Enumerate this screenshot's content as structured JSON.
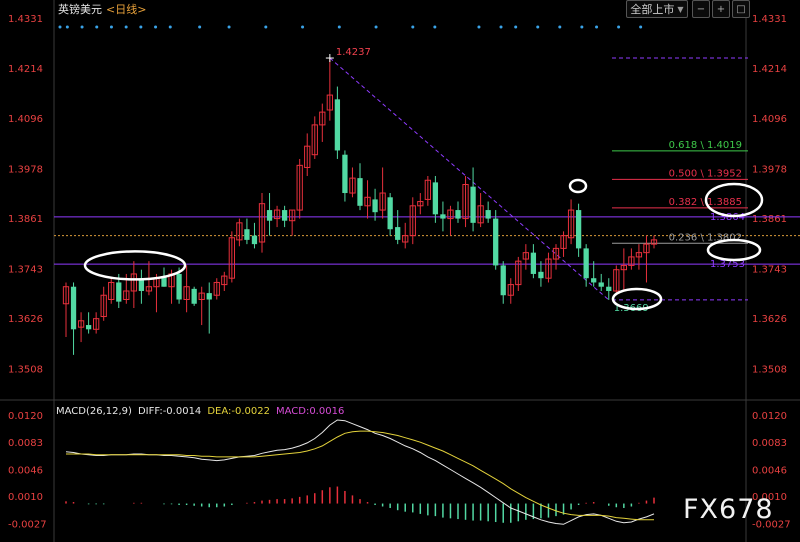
{
  "header": {
    "title": "英镑美元",
    "subtitle": "<日线>",
    "dropdown_label": "全部上市",
    "dropdown_arrow": "▼"
  },
  "macd_header": {
    "label": "MACD(26,12,9)",
    "diff": "DIFF:-0.0014",
    "dea": "DEA:-0.0022",
    "macd": "MACD:0.0016"
  },
  "watermark": "FX678",
  "colors": {
    "background": "#000000",
    "up": "#e8303c",
    "down": "#52d9a3",
    "fib_618": "#3ec94a",
    "fib_500": "#e8304c",
    "fib_382": "#e8304c",
    "fib_236": "#9c9c9c",
    "resistance_line": "#8f3bff",
    "diff_line": "#e6e6e6",
    "dea_line": "#e3d23b",
    "label_price": "#f1414e",
    "label_green": "#52d9a3",
    "axis_text": "#e84141"
  },
  "chart_data": [
    {
      "type": "candlestick",
      "y_ticks": [
        "1.4331",
        "1.4214",
        "1.4096",
        "1.3978",
        "1.3861",
        "1.3743",
        "1.3626",
        "1.3508"
      ],
      "ylim": [
        1.3434,
        1.4331
      ],
      "candles": [
        {
          "o": 1.366,
          "h": 1.371,
          "l": 1.3582,
          "c": 1.37
        },
        {
          "o": 1.37,
          "h": 1.371,
          "l": 1.354,
          "c": 1.36
        },
        {
          "o": 1.3605,
          "h": 1.364,
          "l": 1.357,
          "c": 1.362
        },
        {
          "o": 1.361,
          "h": 1.364,
          "l": 1.359,
          "c": 1.36
        },
        {
          "o": 1.36,
          "h": 1.364,
          "l": 1.359,
          "c": 1.3625
        },
        {
          "o": 1.363,
          "h": 1.37,
          "l": 1.362,
          "c": 1.368
        },
        {
          "o": 1.367,
          "h": 1.372,
          "l": 1.366,
          "c": 1.371
        },
        {
          "o": 1.371,
          "h": 1.373,
          "l": 1.365,
          "c": 1.3665
        },
        {
          "o": 1.367,
          "h": 1.373,
          "l": 1.366,
          "c": 1.369
        },
        {
          "o": 1.369,
          "h": 1.376,
          "l": 1.365,
          "c": 1.373
        },
        {
          "o": 1.372,
          "h": 1.374,
          "l": 1.366,
          "c": 1.369
        },
        {
          "o": 1.369,
          "h": 1.376,
          "l": 1.368,
          "c": 1.37
        },
        {
          "o": 1.37,
          "h": 1.373,
          "l": 1.364,
          "c": 1.372
        },
        {
          "o": 1.3725,
          "h": 1.3745,
          "l": 1.37,
          "c": 1.37
        },
        {
          "o": 1.37,
          "h": 1.374,
          "l": 1.366,
          "c": 1.373
        },
        {
          "o": 1.373,
          "h": 1.3745,
          "l": 1.366,
          "c": 1.367
        },
        {
          "o": 1.367,
          "h": 1.375,
          "l": 1.364,
          "c": 1.37
        },
        {
          "o": 1.3695,
          "h": 1.37,
          "l": 1.3655,
          "c": 1.366
        },
        {
          "o": 1.367,
          "h": 1.37,
          "l": 1.361,
          "c": 1.3685
        },
        {
          "o": 1.3685,
          "h": 1.371,
          "l": 1.359,
          "c": 1.367
        },
        {
          "o": 1.368,
          "h": 1.372,
          "l": 1.367,
          "c": 1.371
        },
        {
          "o": 1.3705,
          "h": 1.3735,
          "l": 1.369,
          "c": 1.3725
        },
        {
          "o": 1.372,
          "h": 1.383,
          "l": 1.371,
          "c": 1.3815
        },
        {
          "o": 1.381,
          "h": 1.386,
          "l": 1.3795,
          "c": 1.385
        },
        {
          "o": 1.3835,
          "h": 1.386,
          "l": 1.38,
          "c": 1.381
        },
        {
          "o": 1.382,
          "h": 1.385,
          "l": 1.379,
          "c": 1.38
        },
        {
          "o": 1.3805,
          "h": 1.392,
          "l": 1.378,
          "c": 1.3895
        },
        {
          "o": 1.388,
          "h": 1.392,
          "l": 1.382,
          "c": 1.3855
        },
        {
          "o": 1.386,
          "h": 1.389,
          "l": 1.384,
          "c": 1.388
        },
        {
          "o": 1.388,
          "h": 1.389,
          "l": 1.384,
          "c": 1.3855
        },
        {
          "o": 1.3855,
          "h": 1.388,
          "l": 1.382,
          "c": 1.388
        },
        {
          "o": 1.388,
          "h": 1.4,
          "l": 1.386,
          "c": 1.3985
        },
        {
          "o": 1.398,
          "h": 1.406,
          "l": 1.396,
          "c": 1.403
        },
        {
          "o": 1.401,
          "h": 1.41,
          "l": 1.4,
          "c": 1.408
        },
        {
          "o": 1.408,
          "h": 1.413,
          "l": 1.404,
          "c": 1.411
        },
        {
          "o": 1.4115,
          "h": 1.4237,
          "l": 1.409,
          "c": 1.415
        },
        {
          "o": 1.414,
          "h": 1.417,
          "l": 1.4,
          "c": 1.402
        },
        {
          "o": 1.401,
          "h": 1.402,
          "l": 1.39,
          "c": 1.392
        },
        {
          "o": 1.392,
          "h": 1.398,
          "l": 1.391,
          "c": 1.3955
        },
        {
          "o": 1.3955,
          "h": 1.399,
          "l": 1.388,
          "c": 1.389
        },
        {
          "o": 1.389,
          "h": 1.395,
          "l": 1.386,
          "c": 1.391
        },
        {
          "o": 1.3905,
          "h": 1.393,
          "l": 1.3855,
          "c": 1.3875
        },
        {
          "o": 1.388,
          "h": 1.398,
          "l": 1.386,
          "c": 1.392
        },
        {
          "o": 1.391,
          "h": 1.392,
          "l": 1.382,
          "c": 1.3835
        },
        {
          "o": 1.384,
          "h": 1.388,
          "l": 1.38,
          "c": 1.381
        },
        {
          "o": 1.3805,
          "h": 1.385,
          "l": 1.379,
          "c": 1.382
        },
        {
          "o": 1.382,
          "h": 1.391,
          "l": 1.38,
          "c": 1.389
        },
        {
          "o": 1.389,
          "h": 1.392,
          "l": 1.387,
          "c": 1.39
        },
        {
          "o": 1.3905,
          "h": 1.396,
          "l": 1.389,
          "c": 1.395
        },
        {
          "o": 1.3945,
          "h": 1.396,
          "l": 1.385,
          "c": 1.387
        },
        {
          "o": 1.387,
          "h": 1.39,
          "l": 1.383,
          "c": 1.386
        },
        {
          "o": 1.386,
          "h": 1.389,
          "l": 1.382,
          "c": 1.388
        },
        {
          "o": 1.388,
          "h": 1.39,
          "l": 1.385,
          "c": 1.386
        },
        {
          "o": 1.386,
          "h": 1.396,
          "l": 1.384,
          "c": 1.394
        },
        {
          "o": 1.3935,
          "h": 1.398,
          "l": 1.383,
          "c": 1.385
        },
        {
          "o": 1.385,
          "h": 1.392,
          "l": 1.384,
          "c": 1.389
        },
        {
          "o": 1.388,
          "h": 1.39,
          "l": 1.385,
          "c": 1.386
        },
        {
          "o": 1.386,
          "h": 1.388,
          "l": 1.374,
          "c": 1.375
        },
        {
          "o": 1.375,
          "h": 1.376,
          "l": 1.366,
          "c": 1.368
        },
        {
          "o": 1.368,
          "h": 1.372,
          "l": 1.366,
          "c": 1.3705
        },
        {
          "o": 1.3705,
          "h": 1.377,
          "l": 1.369,
          "c": 1.376
        },
        {
          "o": 1.3765,
          "h": 1.38,
          "l": 1.374,
          "c": 1.378
        },
        {
          "o": 1.378,
          "h": 1.38,
          "l": 1.372,
          "c": 1.373
        },
        {
          "o": 1.3735,
          "h": 1.376,
          "l": 1.37,
          "c": 1.372
        },
        {
          "o": 1.372,
          "h": 1.378,
          "l": 1.371,
          "c": 1.3765
        },
        {
          "o": 1.3765,
          "h": 1.38,
          "l": 1.374,
          "c": 1.379
        },
        {
          "o": 1.379,
          "h": 1.383,
          "l": 1.377,
          "c": 1.382
        },
        {
          "o": 1.3815,
          "h": 1.3905,
          "l": 1.38,
          "c": 1.388
        },
        {
          "o": 1.388,
          "h": 1.3895,
          "l": 1.377,
          "c": 1.379
        },
        {
          "o": 1.379,
          "h": 1.38,
          "l": 1.37,
          "c": 1.372
        },
        {
          "o": 1.372,
          "h": 1.376,
          "l": 1.37,
          "c": 1.371
        },
        {
          "o": 1.371,
          "h": 1.373,
          "l": 1.369,
          "c": 1.37
        },
        {
          "o": 1.37,
          "h": 1.372,
          "l": 1.3669,
          "c": 1.369
        },
        {
          "o": 1.369,
          "h": 1.375,
          "l": 1.368,
          "c": 1.374
        },
        {
          "o": 1.374,
          "h": 1.379,
          "l": 1.369,
          "c": 1.375
        },
        {
          "o": 1.375,
          "h": 1.379,
          "l": 1.374,
          "c": 1.377
        },
        {
          "o": 1.377,
          "h": 1.38,
          "l": 1.374,
          "c": 1.378
        },
        {
          "o": 1.378,
          "h": 1.382,
          "l": 1.371,
          "c": 1.38
        },
        {
          "o": 1.38,
          "h": 1.382,
          "l": 1.379,
          "c": 1.381
        }
      ],
      "annotations": {
        "high_label": "1.4237",
        "low_label": "1.3669",
        "fib": [
          {
            "label": "0.618 \\ 1.4019",
            "value": 1.4019,
            "key": "fib_618"
          },
          {
            "label": "0.500 \\ 1.3952",
            "value": 1.3952,
            "key": "fib_500"
          },
          {
            "label": "0.382 \\ 1.3885",
            "value": 1.3885,
            "key": "fib_382"
          },
          {
            "label": "0.236 \\ 1.3802",
            "value": 1.3802,
            "key": "fib_236"
          }
        ],
        "fib_top": 1.4237,
        "fib_bottom": 1.3669,
        "resistance_label": "1.3864",
        "resistance_value": 1.3864,
        "support_label": "1.3753",
        "support_value": 1.3753,
        "dashed_level": 1.382
      }
    },
    {
      "type": "macd",
      "y_ticks": [
        "0.0120",
        "0.0083",
        "0.0046",
        "0.0010",
        "-0.0027"
      ],
      "ylim": [
        -0.0052,
        0.014
      ],
      "diff": [
        0.007,
        0.0069,
        0.0067,
        0.0066,
        0.0065,
        0.0065,
        0.0066,
        0.0066,
        0.0066,
        0.0067,
        0.0067,
        0.0066,
        0.0066,
        0.0065,
        0.0065,
        0.0064,
        0.0063,
        0.0062,
        0.006,
        0.0059,
        0.0058,
        0.0059,
        0.0061,
        0.0063,
        0.0064,
        0.0065,
        0.0068,
        0.007,
        0.0072,
        0.0073,
        0.0075,
        0.0078,
        0.0082,
        0.0088,
        0.0096,
        0.0106,
        0.0113,
        0.0112,
        0.0108,
        0.0104,
        0.01,
        0.0095,
        0.0092,
        0.0088,
        0.0083,
        0.0078,
        0.0074,
        0.0069,
        0.0063,
        0.0058,
        0.0052,
        0.0046,
        0.004,
        0.0034,
        0.0028,
        0.0022,
        0.0015,
        0.0008,
        0.0001,
        -0.0006,
        -0.001,
        -0.0014,
        -0.0018,
        -0.0022,
        -0.0025,
        -0.0027,
        -0.0028,
        -0.0023,
        -0.0018,
        -0.0015,
        -0.0014,
        -0.0016,
        -0.002,
        -0.0024,
        -0.0026,
        -0.0025,
        -0.0021,
        -0.0018,
        -0.0014
      ],
      "dea": [
        0.0067,
        0.0067,
        0.0067,
        0.0067,
        0.0066,
        0.0066,
        0.0066,
        0.0066,
        0.0066,
        0.0066,
        0.0066,
        0.0066,
        0.0066,
        0.0066,
        0.0066,
        0.0066,
        0.0065,
        0.0065,
        0.0064,
        0.0064,
        0.0063,
        0.0063,
        0.0063,
        0.0063,
        0.0063,
        0.0063,
        0.0064,
        0.0065,
        0.0066,
        0.0067,
        0.0068,
        0.0069,
        0.0071,
        0.0074,
        0.0078,
        0.0084,
        0.009,
        0.0095,
        0.0097,
        0.0098,
        0.0098,
        0.0097,
        0.0096,
        0.0094,
        0.0092,
        0.0089,
        0.0086,
        0.0083,
        0.0079,
        0.0075,
        0.0071,
        0.0066,
        0.0061,
        0.0056,
        0.0051,
        0.0045,
        0.0039,
        0.0033,
        0.0027,
        0.002,
        0.0014,
        0.0008,
        0.0003,
        -0.0002,
        -0.0006,
        -0.001,
        -0.0013,
        -0.0015,
        -0.0016,
        -0.0016,
        -0.0016,
        -0.0016,
        -0.0017,
        -0.0019,
        -0.002,
        -0.0021,
        -0.0022,
        -0.0022,
        -0.0022
      ],
      "hist": [
        0.0003,
        0.0002,
        0.0,
        -0.0001,
        -0.0001,
        -0.0001,
        0.0,
        0.0,
        0.0,
        0.0001,
        0.0001,
        0.0,
        0.0,
        -0.0001,
        -0.0001,
        -0.0002,
        -0.0002,
        -0.0003,
        -0.0004,
        -0.0005,
        -0.0005,
        -0.0004,
        -0.0002,
        0.0,
        0.0001,
        0.0002,
        0.0004,
        0.0005,
        0.0006,
        0.0006,
        0.0007,
        0.0009,
        0.0011,
        0.0014,
        0.0018,
        0.0022,
        0.0023,
        0.0017,
        0.0011,
        0.0006,
        0.0002,
        -0.0002,
        -0.0004,
        -0.0006,
        -0.0009,
        -0.0011,
        -0.0012,
        -0.0014,
        -0.0016,
        -0.0017,
        -0.0019,
        -0.002,
        -0.0021,
        -0.0022,
        -0.0023,
        -0.0023,
        -0.0024,
        -0.0025,
        -0.0026,
        -0.0026,
        -0.0024,
        -0.0022,
        -0.0021,
        -0.002,
        -0.0019,
        -0.0017,
        -0.0015,
        -0.0008,
        -0.0002,
        0.0001,
        0.0002,
        0.0,
        -0.0003,
        -0.0005,
        -0.0006,
        -0.0004,
        0.0001,
        0.0004,
        0.0008
      ]
    }
  ]
}
